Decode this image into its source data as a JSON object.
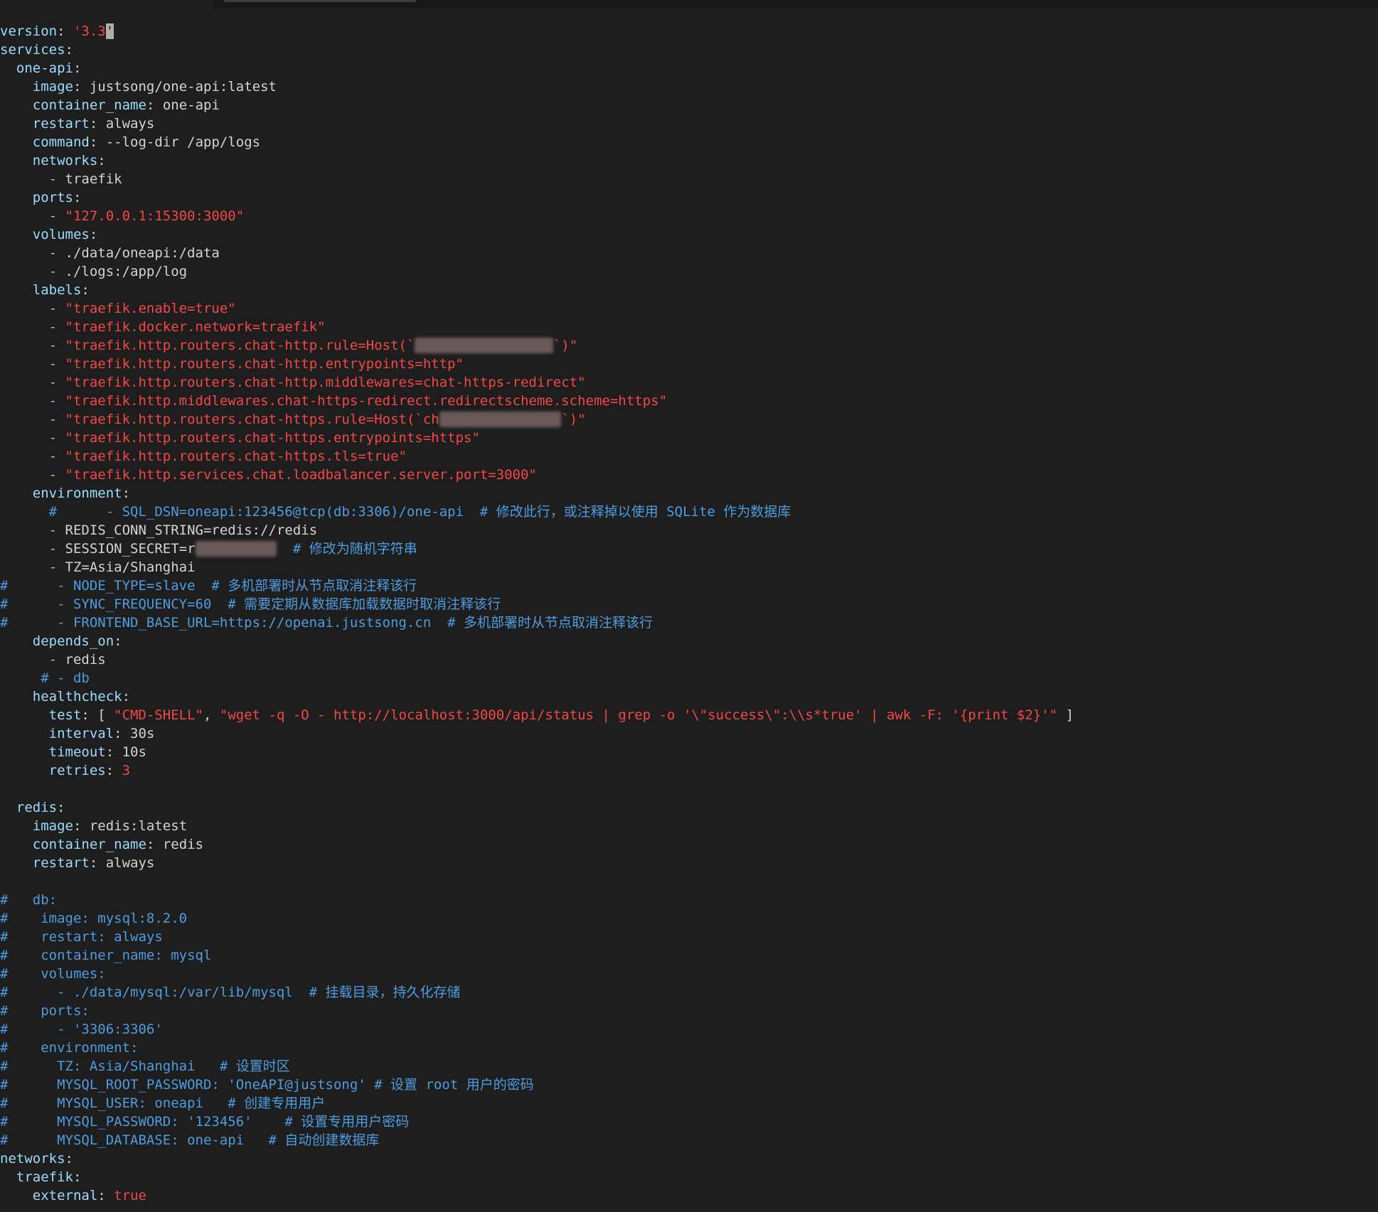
{
  "lines": [
    [
      [
        "key",
        "version"
      ],
      [
        "punc",
        ": "
      ],
      [
        "str",
        "'3.3"
      ],
      [
        "cursor",
        "'"
      ]
    ],
    [
      [
        "key",
        "services"
      ],
      [
        "punc",
        ":"
      ]
    ],
    [
      [
        "plain",
        "  "
      ],
      [
        "key",
        "one-api"
      ],
      [
        "punc",
        ":"
      ]
    ],
    [
      [
        "plain",
        "    "
      ],
      [
        "key",
        "image"
      ],
      [
        "punc",
        ": "
      ],
      [
        "plain",
        "justsong/one-api:latest"
      ]
    ],
    [
      [
        "plain",
        "    "
      ],
      [
        "key",
        "container_name"
      ],
      [
        "punc",
        ": "
      ],
      [
        "plain",
        "one-api"
      ]
    ],
    [
      [
        "plain",
        "    "
      ],
      [
        "key",
        "restart"
      ],
      [
        "punc",
        ": "
      ],
      [
        "plain",
        "always"
      ]
    ],
    [
      [
        "plain",
        "    "
      ],
      [
        "key",
        "command"
      ],
      [
        "punc",
        ": "
      ],
      [
        "plain",
        "--log-dir /app/logs"
      ]
    ],
    [
      [
        "plain",
        "    "
      ],
      [
        "key",
        "networks"
      ],
      [
        "punc",
        ":"
      ]
    ],
    [
      [
        "plain",
        "      "
      ],
      [
        "dash",
        "- "
      ],
      [
        "plain",
        "traefik"
      ]
    ],
    [
      [
        "plain",
        "    "
      ],
      [
        "key",
        "ports"
      ],
      [
        "punc",
        ":"
      ]
    ],
    [
      [
        "plain",
        "      "
      ],
      [
        "dash",
        "- "
      ],
      [
        "str",
        "\"127.0.0.1:15300:3000\""
      ]
    ],
    [
      [
        "plain",
        "    "
      ],
      [
        "key",
        "volumes"
      ],
      [
        "punc",
        ":"
      ]
    ],
    [
      [
        "plain",
        "      "
      ],
      [
        "dash",
        "- "
      ],
      [
        "plain",
        "./data/oneapi:/data"
      ]
    ],
    [
      [
        "plain",
        "      "
      ],
      [
        "dash",
        "- "
      ],
      [
        "plain",
        "./logs:/app/log"
      ]
    ],
    [
      [
        "plain",
        "    "
      ],
      [
        "key",
        "labels"
      ],
      [
        "punc",
        ":"
      ]
    ],
    [
      [
        "plain",
        "      "
      ],
      [
        "dash",
        "- "
      ],
      [
        "str",
        "\"traefik.enable=true\""
      ]
    ],
    [
      [
        "plain",
        "      "
      ],
      [
        "dash",
        "- "
      ],
      [
        "str",
        "\"traefik.docker.network=traefik\""
      ]
    ],
    [
      [
        "plain",
        "      "
      ],
      [
        "dash",
        "- "
      ],
      [
        "str",
        "\"traefik.http.routers.chat-http.rule=Host(`"
      ],
      [
        "redact",
        "xxxxxxxxxxxxxxxxx"
      ],
      [
        "str",
        "`)\""
      ]
    ],
    [
      [
        "plain",
        "      "
      ],
      [
        "dash",
        "- "
      ],
      [
        "str",
        "\"traefik.http.routers.chat-http.entrypoints=http\""
      ]
    ],
    [
      [
        "plain",
        "      "
      ],
      [
        "dash",
        "- "
      ],
      [
        "str",
        "\"traefik.http.routers.chat-http.middlewares=chat-https-redirect\""
      ]
    ],
    [
      [
        "plain",
        "      "
      ],
      [
        "dash",
        "- "
      ],
      [
        "str",
        "\"traefik.http.middlewares.chat-https-redirect.redirectscheme.scheme=https\""
      ]
    ],
    [
      [
        "plain",
        "      "
      ],
      [
        "dash",
        "- "
      ],
      [
        "str",
        "\"traefik.http.routers.chat-https.rule=Host(`ch"
      ],
      [
        "redact",
        "xxxxxxxxxxxxxxx"
      ],
      [
        "str",
        "`)\""
      ]
    ],
    [
      [
        "plain",
        "      "
      ],
      [
        "dash",
        "- "
      ],
      [
        "str",
        "\"traefik.http.routers.chat-https.entrypoints=https\""
      ]
    ],
    [
      [
        "plain",
        "      "
      ],
      [
        "dash",
        "- "
      ],
      [
        "str",
        "\"traefik.http.routers.chat-https.tls=true\""
      ]
    ],
    [
      [
        "plain",
        "      "
      ],
      [
        "dash",
        "- "
      ],
      [
        "str",
        "\"traefik.http.services.chat.loadbalancer.server.port=3000\""
      ]
    ],
    [
      [
        "plain",
        "    "
      ],
      [
        "key",
        "environment"
      ],
      [
        "punc",
        ":"
      ]
    ],
    [
      [
        "plain",
        "      "
      ],
      [
        "cm",
        "#      - SQL_DSN=oneapi:123456@tcp(db:3306)/one-api  # 修改此行，或注释掉以使用 SQLite 作为数据库"
      ]
    ],
    [
      [
        "plain",
        "      "
      ],
      [
        "dash",
        "- "
      ],
      [
        "plain",
        "REDIS_CONN_STRING=redis://redis"
      ]
    ],
    [
      [
        "plain",
        "      "
      ],
      [
        "dash",
        "- "
      ],
      [
        "plain",
        "SESSION_SECRET=r"
      ],
      [
        "redact",
        "xxxxxxxxxx"
      ],
      [
        "plain",
        "  "
      ],
      [
        "cm",
        "# 修改为随机字符串"
      ]
    ],
    [
      [
        "plain",
        "      "
      ],
      [
        "dash",
        "- "
      ],
      [
        "plain",
        "TZ=Asia/Shanghai"
      ]
    ],
    [
      [
        "cm",
        "#      - NODE_TYPE=slave  # 多机部署时从节点取消注释该行"
      ]
    ],
    [
      [
        "cm",
        "#      - SYNC_FREQUENCY=60  # 需要定期从数据库加载数据时取消注释该行"
      ]
    ],
    [
      [
        "cm",
        "#      - FRONTEND_BASE_URL=https://openai.justsong.cn  # 多机部署时从节点取消注释该行"
      ]
    ],
    [
      [
        "plain",
        "    "
      ],
      [
        "key",
        "depends_on"
      ],
      [
        "punc",
        ":"
      ]
    ],
    [
      [
        "plain",
        "      "
      ],
      [
        "dash",
        "- "
      ],
      [
        "plain",
        "redis"
      ]
    ],
    [
      [
        "plain",
        "     "
      ],
      [
        "cm",
        "# - db"
      ]
    ],
    [
      [
        "plain",
        "    "
      ],
      [
        "key",
        "healthcheck"
      ],
      [
        "punc",
        ":"
      ]
    ],
    [
      [
        "plain",
        "      "
      ],
      [
        "key",
        "test"
      ],
      [
        "punc",
        ": [ "
      ],
      [
        "str",
        "\"CMD-SHELL\""
      ],
      [
        "punc",
        ", "
      ],
      [
        "str",
        "\"wget -q -O - http://localhost:3000/api/status | grep -o '\\\"success\\\":\\\\s*true' | awk -F: '{print $2}'\""
      ],
      [
        "punc",
        " ]"
      ]
    ],
    [
      [
        "plain",
        "      "
      ],
      [
        "key",
        "interval"
      ],
      [
        "punc",
        ": "
      ],
      [
        "plain",
        "30s"
      ]
    ],
    [
      [
        "plain",
        "      "
      ],
      [
        "key",
        "timeout"
      ],
      [
        "punc",
        ": "
      ],
      [
        "plain",
        "10s"
      ]
    ],
    [
      [
        "plain",
        "      "
      ],
      [
        "key",
        "retries"
      ],
      [
        "punc",
        ": "
      ],
      [
        "num",
        "3"
      ]
    ],
    [
      [
        "plain",
        ""
      ]
    ],
    [
      [
        "plain",
        "  "
      ],
      [
        "key",
        "redis"
      ],
      [
        "punc",
        ":"
      ]
    ],
    [
      [
        "plain",
        "    "
      ],
      [
        "key",
        "image"
      ],
      [
        "punc",
        ": "
      ],
      [
        "plain",
        "redis:latest"
      ]
    ],
    [
      [
        "plain",
        "    "
      ],
      [
        "key",
        "container_name"
      ],
      [
        "punc",
        ": "
      ],
      [
        "plain",
        "redis"
      ]
    ],
    [
      [
        "plain",
        "    "
      ],
      [
        "key",
        "restart"
      ],
      [
        "punc",
        ": "
      ],
      [
        "plain",
        "always"
      ]
    ],
    [
      [
        "plain",
        ""
      ]
    ],
    [
      [
        "cm",
        "#   db:"
      ]
    ],
    [
      [
        "cm",
        "#    image: mysql:8.2.0"
      ]
    ],
    [
      [
        "cm",
        "#    restart: always"
      ]
    ],
    [
      [
        "cm",
        "#    container_name: mysql"
      ]
    ],
    [
      [
        "cm",
        "#    volumes:"
      ]
    ],
    [
      [
        "cm",
        "#      - ./data/mysql:/var/lib/mysql  # 挂载目录，持久化存储"
      ]
    ],
    [
      [
        "cm",
        "#    ports:"
      ]
    ],
    [
      [
        "cm",
        "#      - '3306:3306'"
      ]
    ],
    [
      [
        "cm",
        "#    environment:"
      ]
    ],
    [
      [
        "cm",
        "#      TZ: Asia/Shanghai   # 设置时区"
      ]
    ],
    [
      [
        "cm",
        "#      MYSQL_ROOT_PASSWORD: 'OneAPI@justsong' # 设置 root 用户的密码"
      ]
    ],
    [
      [
        "cm",
        "#      MYSQL_USER: oneapi   # 创建专用用户"
      ]
    ],
    [
      [
        "cm",
        "#      MYSQL_PASSWORD: '123456'    # 设置专用用户密码"
      ]
    ],
    [
      [
        "cm",
        "#      MYSQL_DATABASE: one-api   # 自动创建数据库"
      ]
    ],
    [
      [
        "key",
        "networks"
      ],
      [
        "punc",
        ":"
      ]
    ],
    [
      [
        "plain",
        "  "
      ],
      [
        "key",
        "traefik"
      ],
      [
        "punc",
        ":"
      ]
    ],
    [
      [
        "plain",
        "    "
      ],
      [
        "key",
        "external"
      ],
      [
        "punc",
        ": "
      ],
      [
        "str",
        "true"
      ]
    ]
  ]
}
